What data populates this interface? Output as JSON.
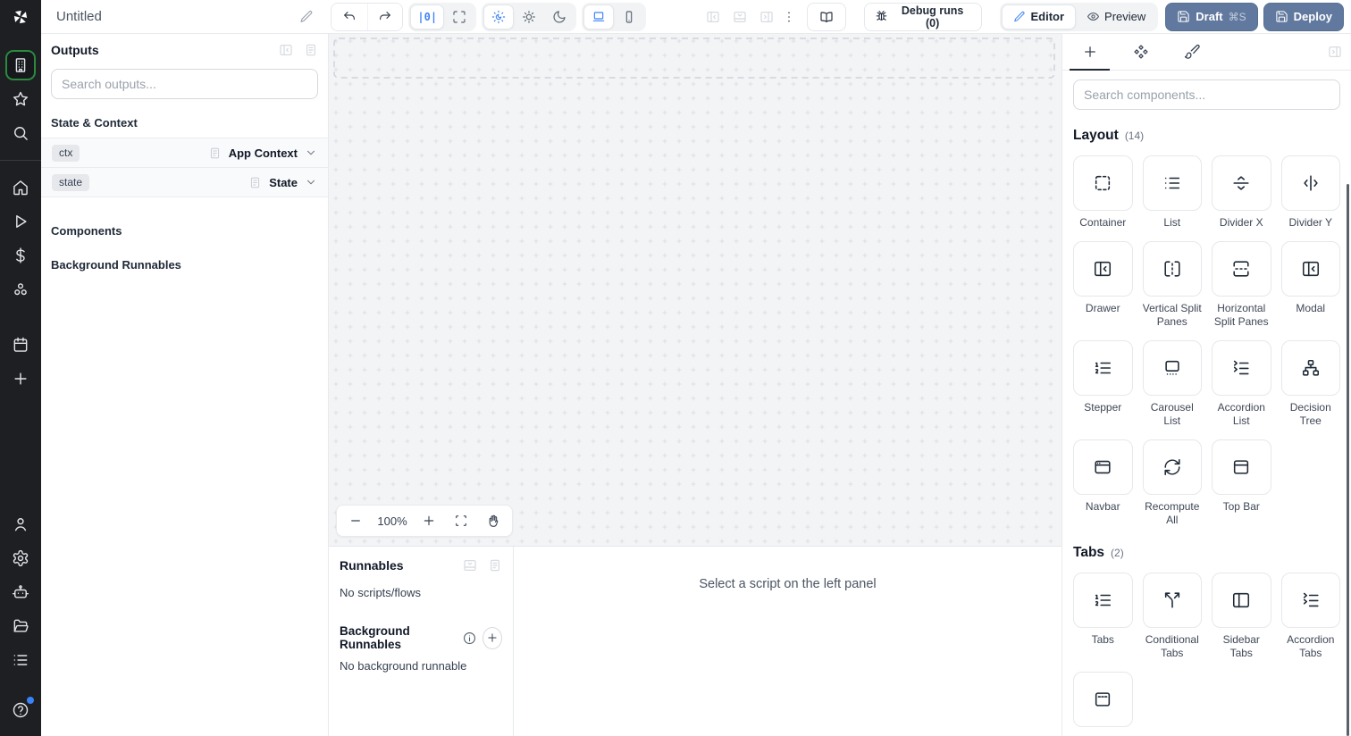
{
  "topbar": {
    "title": "Untitled",
    "zoom_reset_label": "|0|",
    "debug_runs_label": "Debug runs (0)",
    "editor_label": "Editor",
    "preview_label": "Preview",
    "draft_label": "Draft",
    "draft_shortcut": "⌘S",
    "deploy_label": "Deploy",
    "icon_names": [
      "pencil-icon",
      "undo-icon",
      "redo-icon",
      "zoom-reset",
      "fit-view-icon",
      "sun-moon-icon",
      "sun-icon",
      "moon-icon",
      "laptop-icon",
      "smartphone-icon",
      "panel-left-icon",
      "panel-bottom-icon",
      "panel-right-icon",
      "kebab-icon",
      "book-icon",
      "bug-icon",
      "eye-icon",
      "save-icon"
    ]
  },
  "left_rail": {
    "top_items": [
      {
        "name": "rail-item-apps",
        "icon": "building",
        "active": true
      },
      {
        "name": "rail-item-favorites",
        "icon": "star"
      },
      {
        "name": "rail-item-search",
        "icon": "search"
      }
    ],
    "mid_items": [
      {
        "name": "rail-item-home",
        "icon": "home"
      },
      {
        "name": "rail-item-runs",
        "icon": "play"
      },
      {
        "name": "rail-item-variables",
        "icon": "dollar"
      },
      {
        "name": "rail-item-resources",
        "icon": "hub"
      }
    ],
    "lower_items": [
      {
        "name": "rail-item-schedules",
        "icon": "calendar"
      },
      {
        "name": "rail-item-add",
        "icon": "plus"
      }
    ],
    "bottom_items": [
      {
        "name": "rail-item-users",
        "icon": "user"
      },
      {
        "name": "rail-item-settings",
        "icon": "gear"
      },
      {
        "name": "rail-item-workers",
        "icon": "bot"
      },
      {
        "name": "rail-item-folders",
        "icon": "folder"
      },
      {
        "name": "rail-item-logs",
        "icon": "list"
      }
    ]
  },
  "outputs_panel": {
    "title": "Outputs",
    "search_placeholder": "Search outputs...",
    "state_context_heading": "State & Context",
    "rows": [
      {
        "name": "output-row-ctx",
        "badge": "ctx",
        "type": "App Context"
      },
      {
        "name": "output-row-state",
        "badge": "state",
        "type": "State"
      }
    ],
    "components_heading": "Components",
    "background_runnables_heading": "Background Runnables"
  },
  "canvas": {
    "zoom_level": "100%"
  },
  "runnables_panel": {
    "title": "Runnables",
    "empty_scripts": "No scripts/flows",
    "background_title": "Background Runnables",
    "empty_background": "No background runnable"
  },
  "script_panel": {
    "placeholder": "Select a script on the left panel"
  },
  "components_panel": {
    "search_placeholder": "Search components...",
    "sections": [
      {
        "title": "Layout",
        "count": "(14)",
        "items": [
          {
            "name": "component-tile-container",
            "label": "Container",
            "icon": "container"
          },
          {
            "name": "component-tile-list",
            "label": "List",
            "icon": "list-plain"
          },
          {
            "name": "component-tile-divider-x",
            "label": "Divider X",
            "icon": "divider-x"
          },
          {
            "name": "component-tile-divider-y",
            "label": "Divider Y",
            "icon": "divider-y"
          },
          {
            "name": "component-tile-drawer",
            "label": "Drawer",
            "icon": "drawer"
          },
          {
            "name": "component-tile-vertical-split-panes",
            "label": "Vertical Split Panes",
            "icon": "v-split"
          },
          {
            "name": "component-tile-horizontal-split-panes",
            "label": "Horizontal Split Panes",
            "icon": "h-split"
          },
          {
            "name": "component-tile-modal",
            "label": "Modal",
            "icon": "modal"
          },
          {
            "name": "component-tile-stepper",
            "label": "Stepper",
            "icon": "list-ordered"
          },
          {
            "name": "component-tile-carousel-list",
            "label": "Carousel List",
            "icon": "carousel"
          },
          {
            "name": "component-tile-accordion-list",
            "label": "Accordion List",
            "icon": "list-collapse"
          },
          {
            "name": "component-tile-decision-tree",
            "label": "Decision Tree",
            "icon": "tree"
          },
          {
            "name": "component-tile-navbar",
            "label": "Navbar",
            "icon": "navbar"
          },
          {
            "name": "component-tile-recompute-all",
            "label": "Recompute All",
            "icon": "refresh"
          },
          {
            "name": "component-tile-top-bar",
            "label": "Top Bar",
            "icon": "topbar"
          }
        ]
      },
      {
        "title": "Tabs",
        "count": "(2)",
        "items": [
          {
            "name": "component-tile-tabs",
            "label": "Tabs",
            "icon": "tabs"
          },
          {
            "name": "component-tile-conditional-tabs",
            "label": "Conditional Tabs",
            "icon": "split"
          },
          {
            "name": "component-tile-sidebar-tabs",
            "label": "Sidebar Tabs",
            "icon": "panel-left"
          },
          {
            "name": "component-tile-accordion-tabs",
            "label": "Accordion Tabs",
            "icon": "accordion-tabs"
          },
          {
            "name": "component-tile-partial",
            "label": "",
            "icon": "dash-top-rect"
          }
        ]
      }
    ]
  },
  "colors": {
    "accent_blue": "#3b82f6",
    "brand_green": "#2b8a3e",
    "action_button": "#61799f",
    "rail_bg": "#1d1f23",
    "canvas_bg": "#f3f4f6"
  }
}
